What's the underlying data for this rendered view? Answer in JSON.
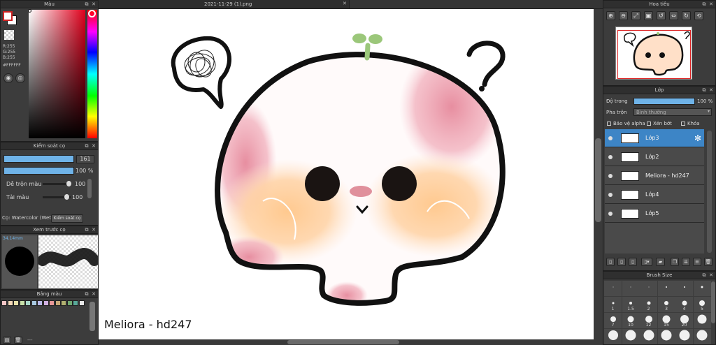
{
  "color_panel": {
    "title": "Màu",
    "r": "R:255",
    "g": "G:255",
    "b": "B:255",
    "hex": "#FFFFFF"
  },
  "brush_control": {
    "title": "Kiểm soát cọ",
    "size_value": "161",
    "opacity_value": "100 %",
    "blend_label": "Dễ trộn màu",
    "blend_value": "100",
    "load_label": "Tải màu",
    "load_value": "100",
    "brush_name": "Cọ: Watercolor (Wet)",
    "control_button": "Kiểm soát cọ"
  },
  "brush_preview": {
    "title": "Xem trước cọ",
    "size_text": "34.14mm"
  },
  "palette": {
    "title": "Bảng màu",
    "swatches": [
      "#f4c6c6",
      "#f4d8b8",
      "#e8e0a8",
      "#c8e0a8",
      "#a8d8c8",
      "#a8c8e0",
      "#b8b8e8",
      "#d0b0e0",
      "#e89898",
      "#c8a878",
      "#b0b070",
      "#70a870",
      "#58a898",
      "#e8e8e8"
    ],
    "bottom_text": "---"
  },
  "document": {
    "tab_title": "2021-11-29 (1).png"
  },
  "canvas": {
    "signature": "Meliora - hd247"
  },
  "navigator": {
    "title": "Hoa tiêu"
  },
  "layers": {
    "title": "Lớp",
    "opacity_label": "Độ trong",
    "opacity_value": "100 %",
    "blend_label": "Pha trộn",
    "blend_value": "Bình thường",
    "protect_alpha": "Bảo vệ alpha",
    "clipping": "Xén bớt",
    "lock": "Khóa",
    "items": [
      {
        "name": "Lớp3"
      },
      {
        "name": "Lớp2"
      },
      {
        "name": "Meliora - hd247"
      },
      {
        "name": "Lớp4"
      },
      {
        "name": "Lớp5"
      }
    ]
  },
  "brush_size": {
    "title": "Brush Size",
    "row1": [
      "",
      "",
      "",
      "",
      "",
      ""
    ],
    "row2": [
      "1",
      "1.5",
      "2",
      "3",
      "4",
      "5"
    ],
    "row3": [
      "7",
      "10",
      "12",
      "15",
      "20",
      ""
    ]
  }
}
